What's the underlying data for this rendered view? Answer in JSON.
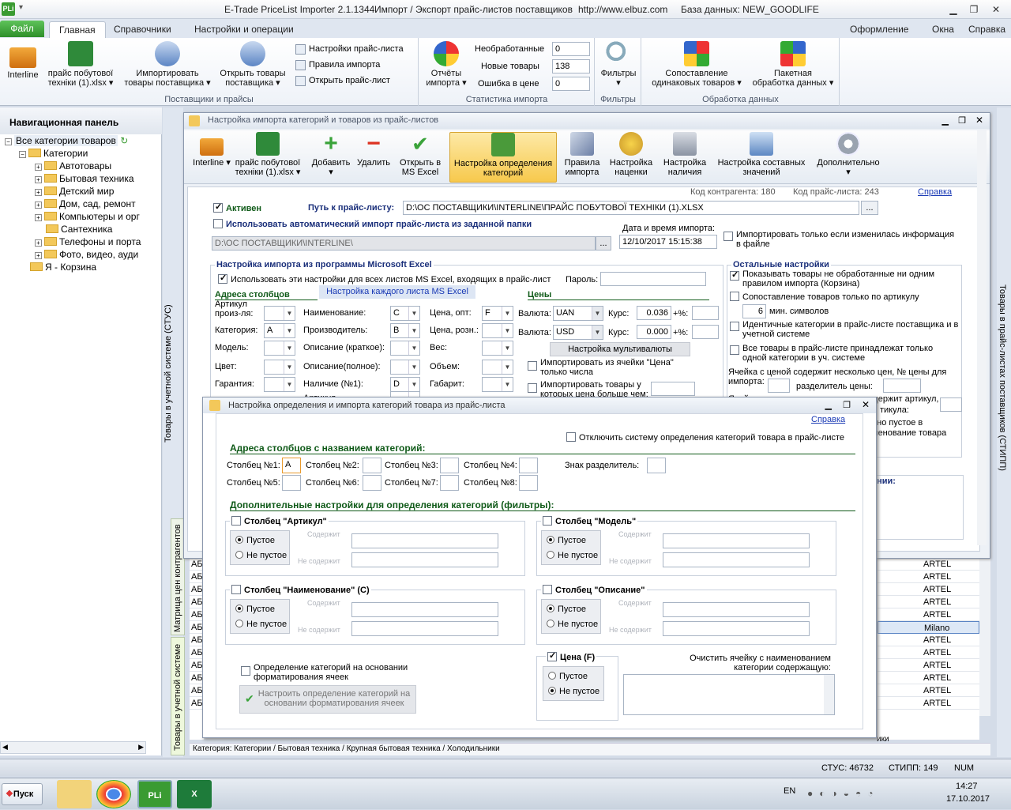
{
  "app": {
    "title": "E-Trade PriceList Importer 2.1.1344",
    "subtitle": "Импорт / Экспорт прайс-листов поставщиков",
    "url": "http://www.elbuz.com",
    "db": "База данных: NEW_GOODLIFE",
    "logo": "PLi"
  },
  "ribbon_tabs": [
    "Файл",
    "Главная",
    "Справочники",
    "Настройки и операции"
  ],
  "ribbon_right": [
    "Оформление",
    "Окна",
    "Справка"
  ],
  "ribbon": {
    "interline": "Interline",
    "pricefile_1": "прайс побутової",
    "pricefile_2": "техніки  (1).xlsx",
    "import_1": "Импортировать",
    "import_2": "товары поставщика",
    "open_1": "Открыть товары",
    "open_2": "поставщика",
    "price_settings": "Настройки прайс-листа",
    "import_rules": "Правила импорта",
    "open_price": "Открыть прайс-лист",
    "group_suppliers": "Поставщики и прайсы",
    "reports_1": "Отчёты",
    "reports_2": "импорта",
    "unprocessed_label": "Необработанные",
    "unprocessed_value": "0",
    "new_label": "Новые товары",
    "new_value": "138",
    "error_label": "Ошибка в цене",
    "error_value": "0",
    "group_stats": "Статистика импорта",
    "filters": "Фильтры",
    "group_filters": "Фильтры",
    "match_1": "Сопоставление",
    "match_2": "одинаковых товаров",
    "batch_1": "Пакетная",
    "batch_2": "обработка данных",
    "group_processing": "Обработка данных"
  },
  "nav": {
    "title": "Навигационная панель",
    "root": "Все категории товаров",
    "categories": "Категории",
    "items": [
      "Автотовары",
      "Бытовая техника",
      "Детский мир",
      "Дом, сад, ремонт",
      "Компьютеры и орг",
      "Сантехника",
      "Телефоны и порта",
      "Фото, видео, ауди"
    ],
    "basket": "Я - Корзина"
  },
  "side_tabs": {
    "left1": "Товары в учетной системе (СТУС)",
    "left2": "Матрица цен контрагентов",
    "left3": "Товары в учетной системе",
    "right": "Товары в прайс-листах поставщиков (СТИПП)"
  },
  "win1": {
    "title": "Настройка импорта категорий и товаров из прайс-листов",
    "toolbar": [
      "Interline",
      "прайс побутової техніки (1).xlsx",
      "Добавить",
      "Удалить",
      "Открыть в MS Excel",
      "Настройка определения категорий",
      "Правила импорта",
      "Настройка наценки",
      "Настройка наличия",
      "Настройка составных значений",
      "Дополнительно"
    ],
    "contractor_code": "Код контрагента: 180",
    "price_code": "Код прайс-листа: 243",
    "help": "Справка",
    "active": "Активен",
    "path_label": "Путь к прайс-листу:",
    "path_value": "D:\\ОС ПОСТАВЩИКИ\\INTERLINE\\ПРАЙС ПОБУТОВОЇ ТЕХНІКИ  (1).XLSX",
    "auto_import": "Использовать автоматический импорт прайс-листа из заданной папки",
    "folder_value": "D:\\ОС ПОСТАВЩИКИ\\INTERLINE\\",
    "date_label": "Дата и время импорта:",
    "date_value": "12/10/2017 15:15:38",
    "import_if_changed": "Импортировать только если изменилась информация в файле",
    "excel_section": "Настройка импорта из программы Microsoft Excel",
    "use_all_sheets": "Использовать эти настройки для всех листов MS Excel, входящих в прайс-лист",
    "password": "Пароль:",
    "col_addresses": "Адреса столбцов",
    "each_sheet": "Настройка каждого листа MS Excel",
    "prices": "Цены",
    "fields": [
      {
        "label": "Артикул произ-ля:",
        "value": ""
      },
      {
        "label": "Категория:",
        "value": "A"
      },
      {
        "label": "Модель:",
        "value": ""
      },
      {
        "label": "Цвет:",
        "value": ""
      },
      {
        "label": "Гарантия:",
        "value": ""
      }
    ],
    "fields2": [
      {
        "label": "Наименование:",
        "value": "C"
      },
      {
        "label": "Производитель:",
        "value": "B"
      },
      {
        "label": "Описание (краткое):",
        "value": ""
      },
      {
        "label": "Описание(полное):",
        "value": ""
      },
      {
        "label": "Наличие (№1):",
        "value": "D"
      },
      {
        "label": "Артикул",
        "value": ""
      }
    ],
    "fields3": [
      {
        "label": "Цена, опт:",
        "value": "F"
      },
      {
        "label": "Цена, розн.:",
        "value": ""
      },
      {
        "label": "Вес:",
        "value": ""
      },
      {
        "label": "Объем:",
        "value": ""
      },
      {
        "label": "Габарит:",
        "value": ""
      }
    ],
    "currency1": "UAN",
    "rate1": "0.036",
    "currency2": "USD",
    "rate2": "0.000",
    "currency_label": "Валюта:",
    "rate_label": "Курс:",
    "pct_label": "+%:",
    "multicurrency": "Настройка мультивалюты",
    "import_from_price_cell": "Импортировать из ячейки \"Цена\" только числа",
    "import_goods_price_gt": "Импортировать товары у которых цена больше чем:",
    "other_settings": "Остальные настройки",
    "other": [
      {
        "text": "Показывать товары не обработанные ни одним правилом импорта (Корзина)",
        "checked": true
      },
      {
        "text": "Сопоставление товаров только по артикулу",
        "checked": false
      },
      {
        "text": "Идентичные категории в прайс-листе поставщика и в учетной системе",
        "checked": false
      },
      {
        "text": "Все товары в прайс-листе принадлежат только одной категории в уч. системе",
        "checked": false
      }
    ],
    "min_symbols_value": "6",
    "min_symbols": "мин. символов",
    "multi_price_cell": "Ячейка с ценой содержит несколько цен, № цены для импорта:",
    "price_separator": "разделитель цены:",
    "name_contains_article": "Ячейка с наименованием товара содержит артикул,",
    "article_sep": "тикула:",
    "empty_1": "оно пустое в",
    "empty_2": "менование товара",
    "extra_label": "ании:"
  },
  "win2": {
    "title": "Настройка определения и импорта категорий товара из прайс-листа",
    "help": "Справка",
    "disable_system": "Отключить систему определения категорий товара в прайс-листе",
    "section1": "Адреса столбцов с названием категорий:",
    "columns": [
      {
        "label": "Столбец №1:",
        "value": "A"
      },
      {
        "label": "Столбец №2:",
        "value": ""
      },
      {
        "label": "Столбец №3:",
        "value": ""
      },
      {
        "label": "Столбец №4:",
        "value": ""
      },
      {
        "label": "Столбец №5:",
        "value": ""
      },
      {
        "label": "Столбец №6:",
        "value": ""
      },
      {
        "label": "Столбец №7:",
        "value": ""
      },
      {
        "label": "Столбец №8:",
        "value": ""
      }
    ],
    "separator": "Знак разделитель:",
    "section2": "Дополнительные настройки для определения категорий (фильтры):",
    "filters": [
      {
        "title": "Столбец \"Артикул\"",
        "selected": "empty"
      },
      {
        "title": "Столбец \"Модель\"",
        "selected": "empty"
      },
      {
        "title": "Столбец \"Наименование\" (C)",
        "selected": "empty"
      },
      {
        "title": "Столбец \"Описание\"",
        "selected": "empty"
      }
    ],
    "empty": "Пустое",
    "not_empty": "Не пустое",
    "contains": "Содержит",
    "not_contains": "Не содержит",
    "format_detect": "Определение категорий на основании форматирования ячеек",
    "format_btn": "Настроить определение категорий на основании форматирования ячеек",
    "price_title": "Цена (F)",
    "price_checked": true,
    "price_selected": "not_empty",
    "clear_cell": "Очистить ячейку с наименованием категории содержащую:"
  },
  "grid": {
    "left_rows": [
      "АБ",
      "АБ",
      "АБ",
      "АБ",
      "АБ",
      "АБ",
      "АБ",
      "АБ",
      "АБ",
      "АБ",
      "АБ",
      "АБ"
    ],
    "brands": [
      "ARTEL",
      "ARTEL",
      "ARTEL",
      "ARTEL",
      "ARTEL",
      "Milano",
      "ARTEL",
      "ARTEL",
      "ARTEL",
      "ARTEL",
      "ARTEL",
      "ARTEL"
    ],
    "tail": "ики"
  },
  "breadcrumb": "Категория: Категории / Бытовая техника / Крупная бытовая техника / Холодильники",
  "status": {
    "stus": "СТУС: 46732",
    "stipp": "СТИПП: 149",
    "num": "NUM"
  },
  "taskbar": {
    "start": "Пуск",
    "lang": "EN",
    "time": "14:27",
    "date": "17.10.2017"
  }
}
